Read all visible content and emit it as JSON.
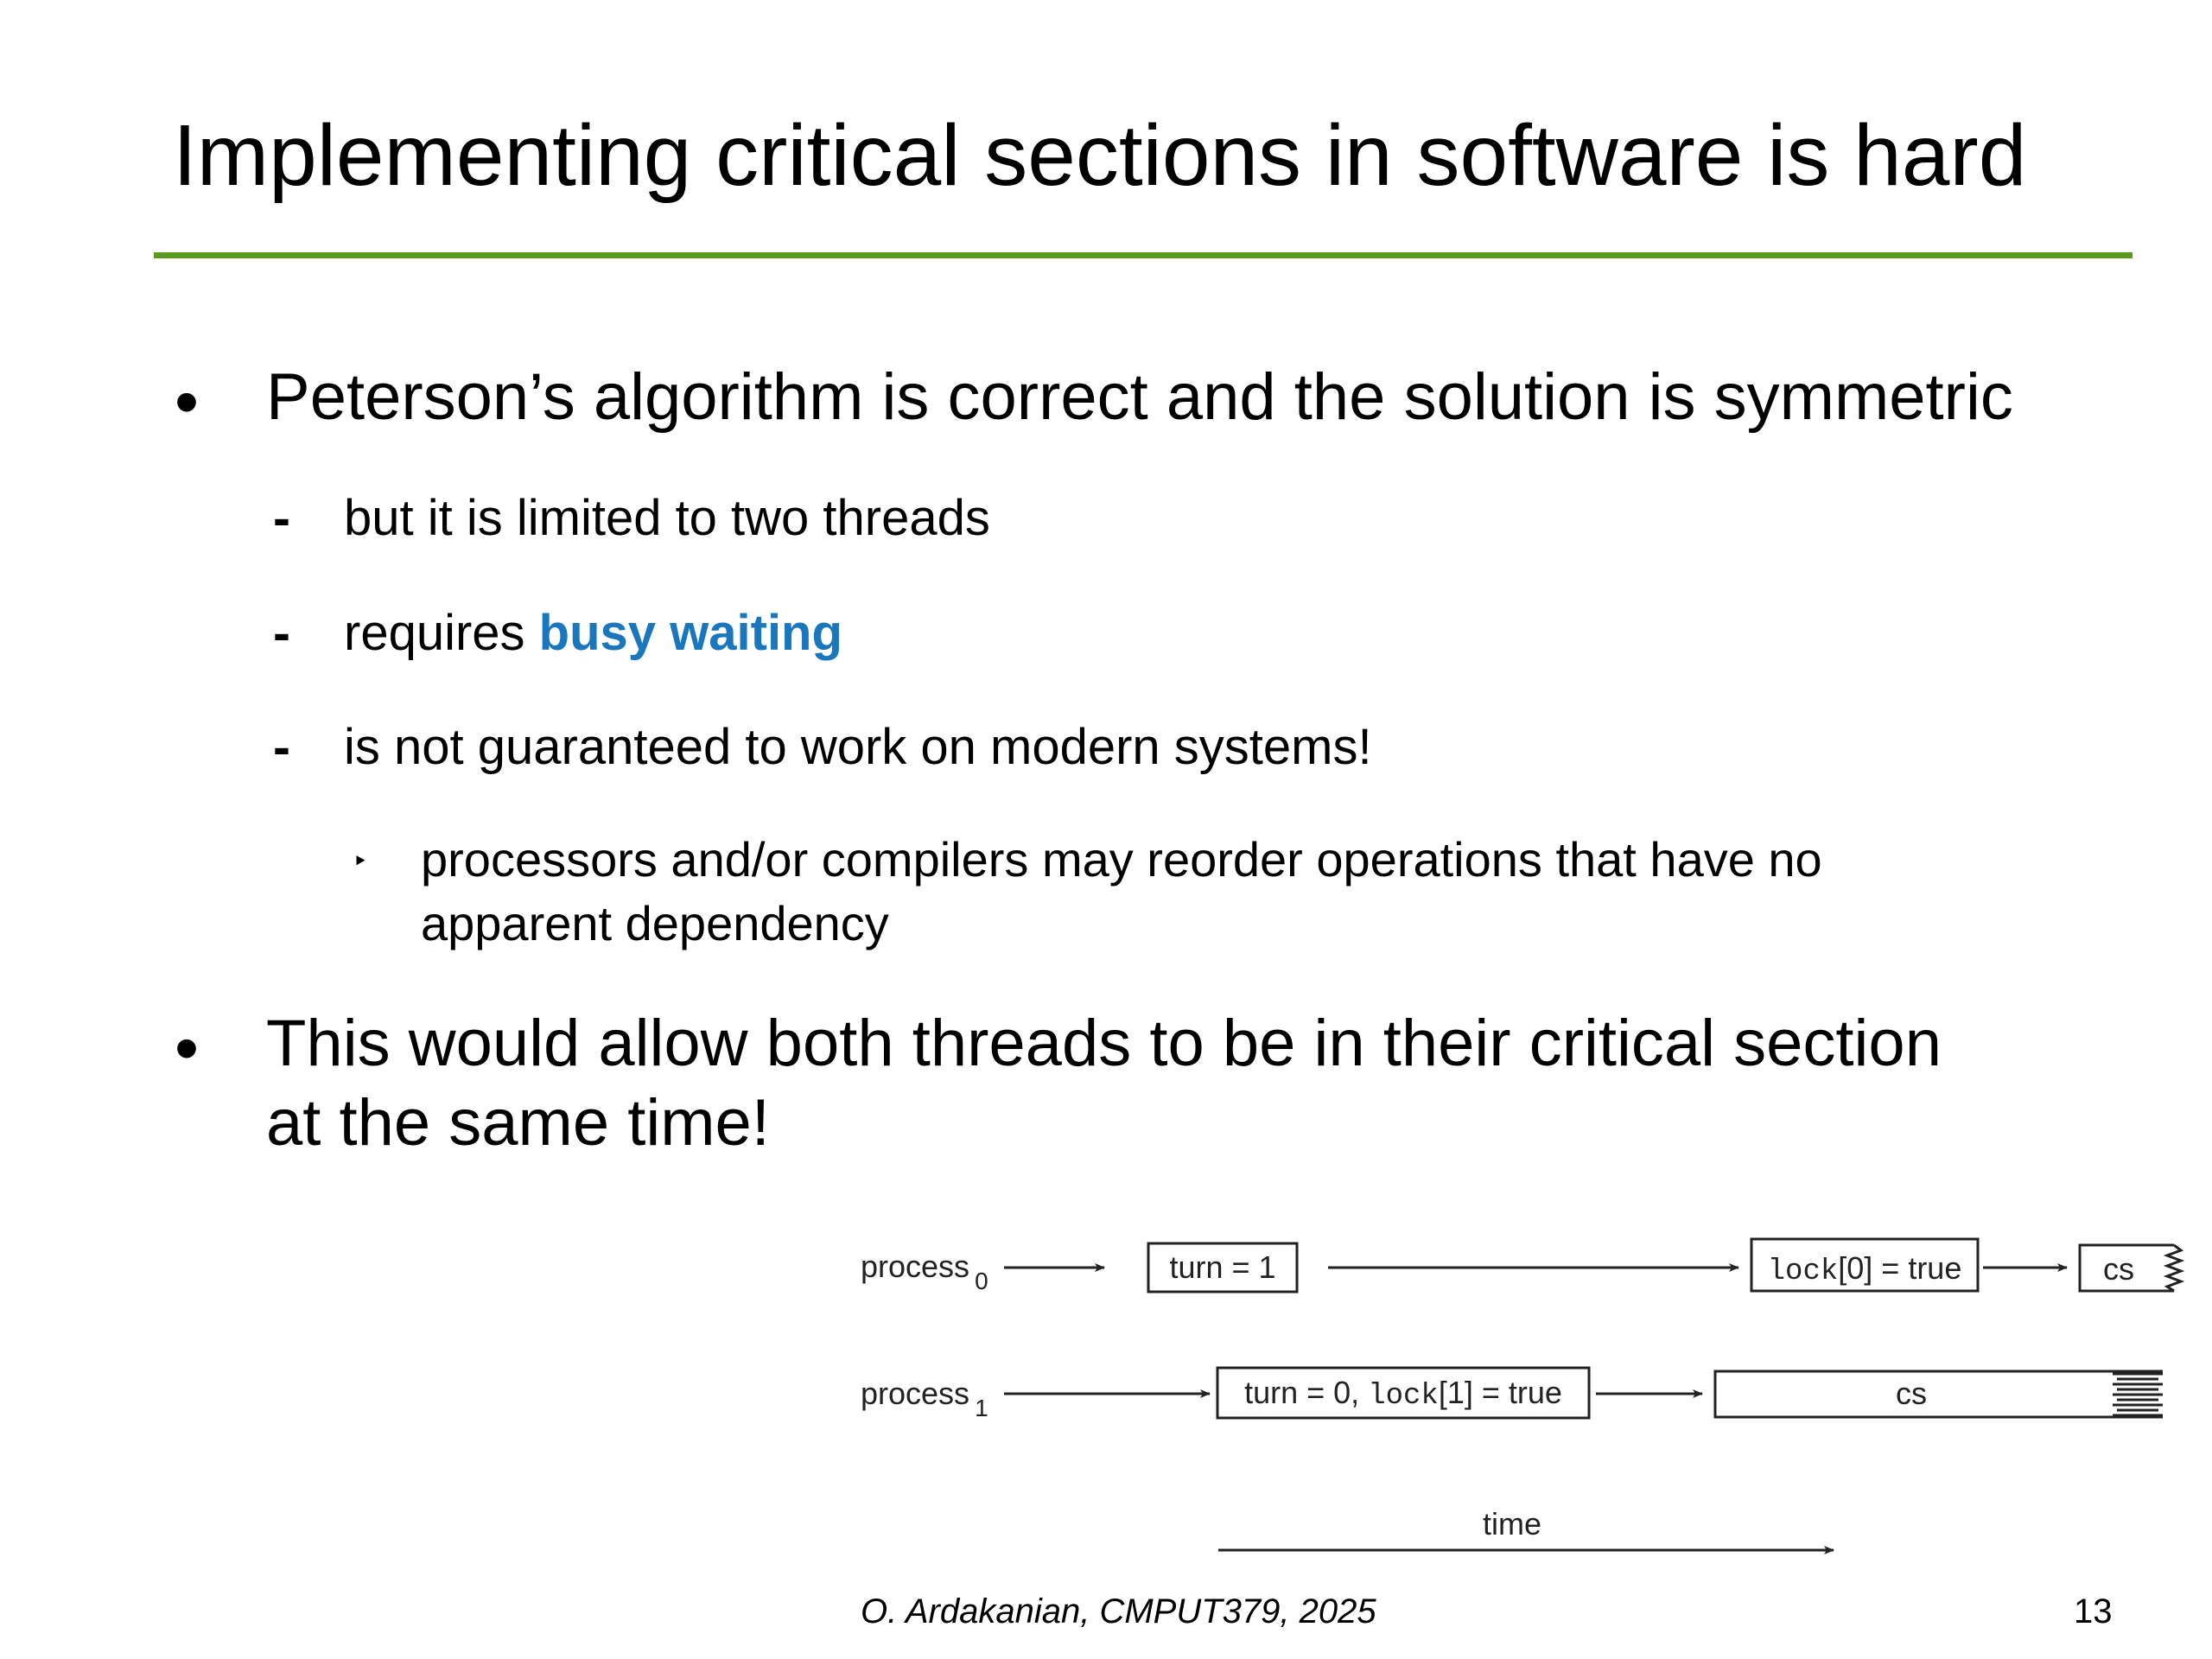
{
  "slide": {
    "title": "Implementing critical sections in software is hard",
    "accent_color": "#5a9a1f",
    "highlight_color": "#1a76bd",
    "bullets": [
      {
        "marker": "•",
        "text_lines": [
          "Peterson’s algorithm is correct and the solution is symmetric"
        ],
        "sub": [
          {
            "marker": "-",
            "text": "but it is limited to two threads"
          },
          {
            "marker": "-",
            "text_prefix": "requires ",
            "highlight": "busy waiting"
          },
          {
            "marker": "-",
            "text": "is not guaranteed to work on modern systems!",
            "sub": [
              {
                "marker": "‣",
                "text_lines": [
                  "processors and/or compilers may reorder operations that have no",
                  "apparent dependency"
                ]
              }
            ]
          }
        ]
      },
      {
        "marker": "•",
        "text_lines": [
          "This would allow both threads to be in their critical section",
          "at the same time!"
        ]
      }
    ],
    "footer": {
      "credit": "O. Ardakanian, CMPUT379, 2025",
      "page_number": "13"
    }
  },
  "diagram": {
    "rows": [
      {
        "label": "process",
        "subscript": "0",
        "boxes": [
          {
            "parts": [
              {
                "t": "turn = 1"
              }
            ]
          },
          {
            "parts": [
              {
                "t": "lock",
                "mono": true
              },
              {
                "t": "[0] = true"
              }
            ]
          },
          {
            "parts": [
              {
                "t": "cs"
              }
            ]
          }
        ]
      },
      {
        "label": "process",
        "subscript": "1",
        "boxes": [
          {
            "parts": [
              {
                "t": "turn = 0, "
              },
              {
                "t": "lock",
                "mono": true
              },
              {
                "t": "[1] = true"
              }
            ]
          },
          {
            "parts": [
              {
                "t": "cs"
              }
            ]
          }
        ]
      }
    ],
    "time_label": "time"
  }
}
